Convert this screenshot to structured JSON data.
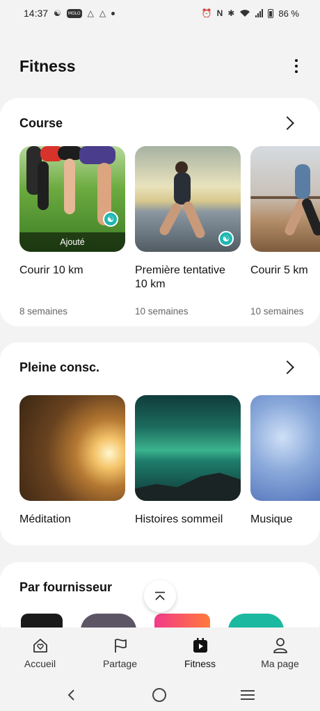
{
  "status_bar": {
    "time": "14:37",
    "app_pill": "MOLO",
    "battery": "86 %",
    "icons": [
      "yoga-icon",
      "app-icon",
      "drive-icon",
      "drive-icon",
      "dot",
      "alarm-icon",
      "nfc-icon",
      "bluetooth-icon",
      "wifi-icon",
      "signal-icon",
      "battery-icon"
    ]
  },
  "header": {
    "title": "Fitness",
    "menu_icon": "more-vertical-icon"
  },
  "course": {
    "title": "Course",
    "items": [
      {
        "name": "Courir 10 km",
        "sub": "8 semaines",
        "added_label": "Ajouté"
      },
      {
        "name": "Première tentative 10 km",
        "sub": "10 semaines"
      },
      {
        "name": "Courir 5 km",
        "sub": "10 semaines"
      }
    ]
  },
  "mindfulness": {
    "title": "Pleine consc.",
    "items": [
      {
        "name": "Méditation"
      },
      {
        "name": "Histoires sommeil"
      },
      {
        "name": "Musique"
      }
    ]
  },
  "providers": {
    "title": "Par fournisseur"
  },
  "bottom_nav": {
    "items": [
      {
        "label": "Accueil",
        "icon": "home-heart-icon"
      },
      {
        "label": "Partage",
        "icon": "flag-icon"
      },
      {
        "label": "Fitness",
        "icon": "fitness-play-icon",
        "active": true
      },
      {
        "label": "Ma page",
        "icon": "person-icon"
      }
    ]
  },
  "colors": {
    "background": "#f3f3f3",
    "card": "#ffffff",
    "badge": "#1fb7b2",
    "text": "#111111",
    "secondary_text": "#666666"
  }
}
